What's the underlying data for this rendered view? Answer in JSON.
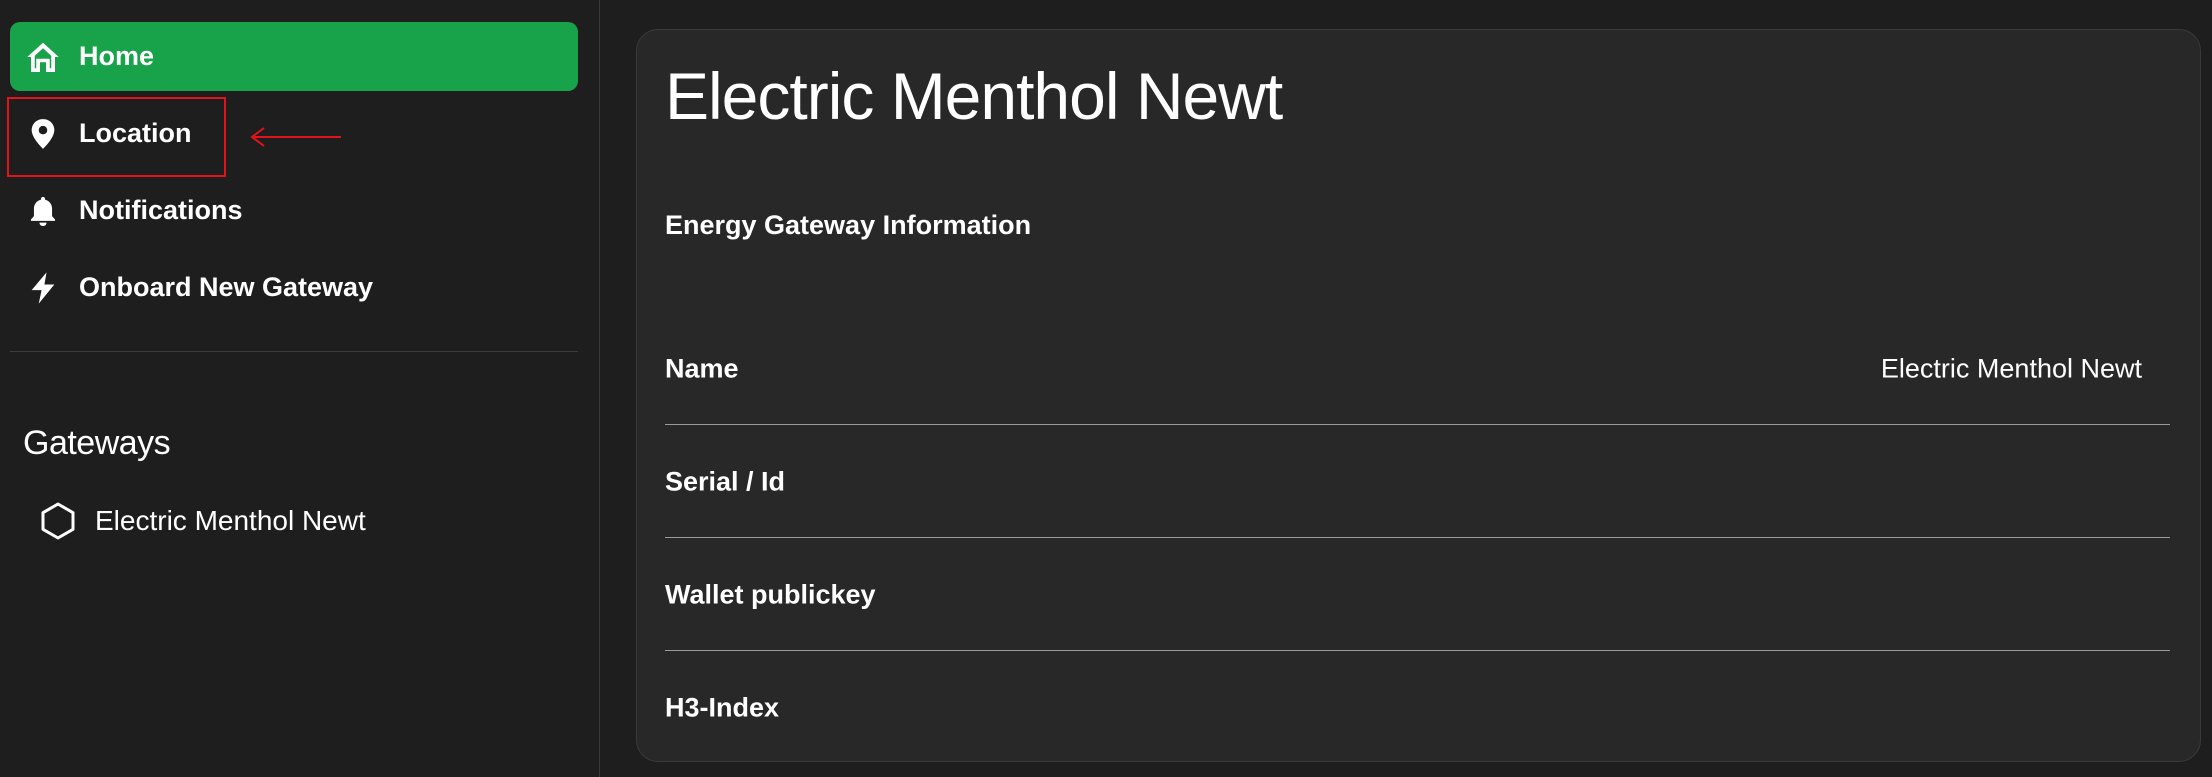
{
  "sidebar": {
    "nav": [
      {
        "label": "Home",
        "icon": "home-icon",
        "active": true
      },
      {
        "label": "Location",
        "icon": "location-pin-icon",
        "active": false
      },
      {
        "label": "Notifications",
        "icon": "bell-icon",
        "active": false
      },
      {
        "label": "Onboard New Gateway",
        "icon": "lightning-bolt-icon",
        "active": false
      }
    ],
    "gateways_heading": "Gateways",
    "gateways": [
      {
        "label": "Electric Menthol Newt",
        "icon": "hexagon-icon"
      }
    ]
  },
  "main": {
    "title": "Electric Menthol Newt",
    "section_title": "Energy Gateway Information",
    "rows": [
      {
        "label": "Name",
        "value": "Electric Menthol Newt"
      },
      {
        "label": "Serial / Id",
        "value": ""
      },
      {
        "label": "Wallet publickey",
        "value": ""
      },
      {
        "label": "H3-Index",
        "value": ""
      }
    ]
  },
  "colors": {
    "background": "#1e1e1e",
    "card": "#282828",
    "accent_green": "#18a34a",
    "annotation_red": "#e0141a",
    "text": "#ffffff"
  }
}
